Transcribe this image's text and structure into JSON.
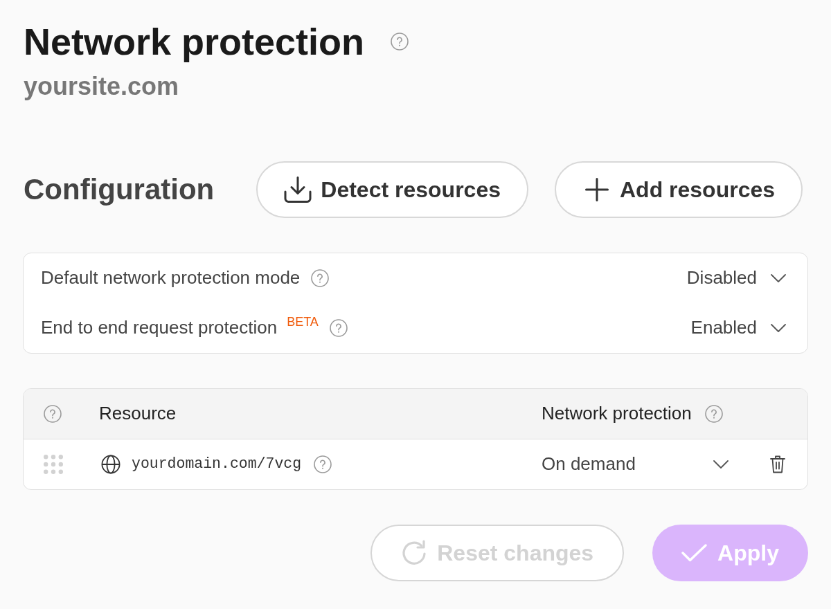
{
  "header": {
    "title": "Network protection",
    "help": true,
    "subtitle": "yoursite.com"
  },
  "configuration": {
    "heading": "Configuration",
    "actions": [
      {
        "kind": "detect",
        "label": "Detect resources"
      },
      {
        "kind": "add",
        "label": "Add resources"
      }
    ]
  },
  "settings": [
    {
      "label": "Default network protection mode",
      "help": true,
      "value": "Disabled"
    },
    {
      "label": "End to end request protection",
      "badge": "BETA",
      "help": true,
      "value": "Enabled"
    }
  ],
  "resources_table": {
    "columns": [
      {
        "kind": "handle",
        "help": true
      },
      {
        "kind": "label",
        "label": "Resource",
        "help": false
      },
      {
        "kind": "label",
        "label": "Network protection",
        "help": true
      }
    ],
    "rows": [
      {
        "resource": "yourdomain.com/7vcg",
        "help": true,
        "protection": "On demand"
      }
    ]
  },
  "footer_actions": [
    {
      "kind": "reset",
      "label": "Reset changes",
      "disabled": true
    },
    {
      "kind": "apply",
      "label": "Apply",
      "disabled": true
    }
  ]
}
